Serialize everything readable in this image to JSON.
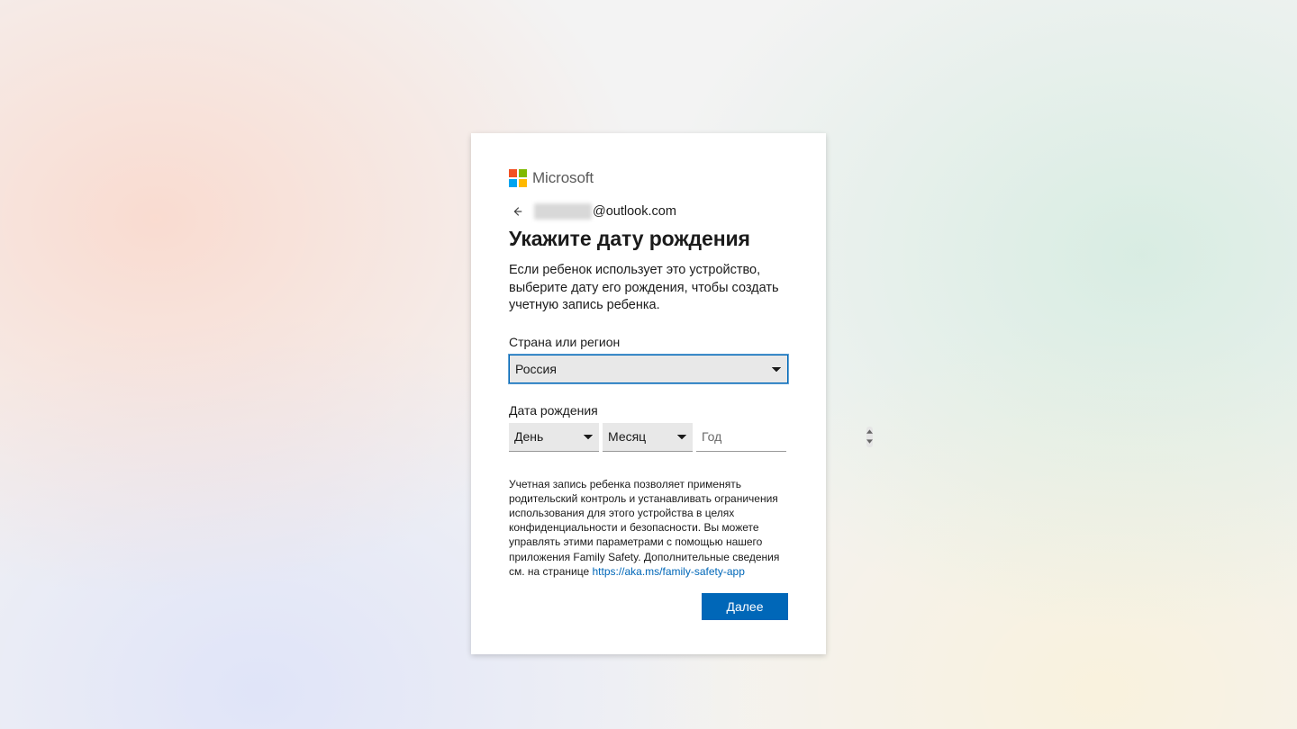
{
  "brand": {
    "name": "Microsoft"
  },
  "identity": {
    "email_domain": "@outlook.com"
  },
  "title": "Укажите дату рождения",
  "subtitle": "Если ребенок использует это устройство, выберите дату его рождения, чтобы создать учетную запись ребенка.",
  "country": {
    "label": "Страна или регион",
    "selected": "Россия"
  },
  "dob": {
    "label": "Дата рождения",
    "day_placeholder": "День",
    "month_placeholder": "Месяц",
    "year_placeholder": "Год"
  },
  "fine_print": {
    "text": "Учетная запись ребенка позволяет применять родительский контроль и устанавливать ограничения использования для этого устройства в целях конфиденциальности и безопасности. Вы можете управлять этими параметрами с помощью нашего приложения Family Safety. Дополнительные сведения см. на странице ",
    "link_text": "https://aka.ms/family-safety-app"
  },
  "actions": {
    "next": "Далее"
  },
  "colors": {
    "accent": "#0067b8"
  }
}
